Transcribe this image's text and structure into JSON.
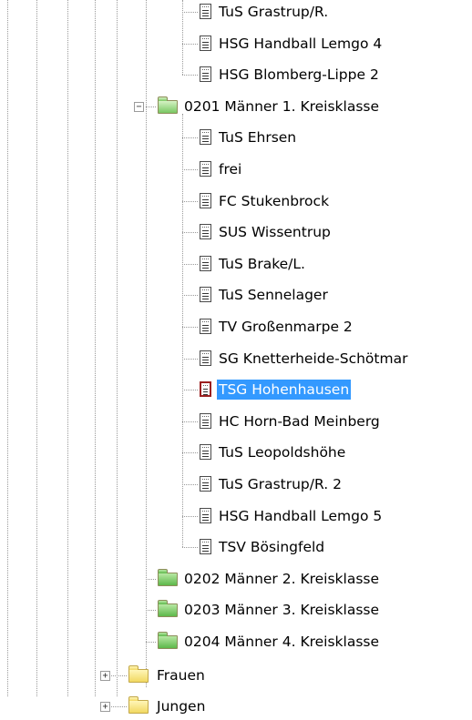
{
  "tree": {
    "teams_top": [
      {
        "label": "TuS Grastrup/R."
      },
      {
        "label": "HSG Handball Lemgo 4"
      },
      {
        "label": "HSG Blomberg-Lippe 2"
      }
    ],
    "league_open": {
      "label": "0201 Männer 1. Kreisklasse",
      "expander": "−"
    },
    "teams": [
      {
        "label": "TuS Ehrsen"
      },
      {
        "label": "frei"
      },
      {
        "label": "FC Stukenbrock"
      },
      {
        "label": "SUS Wissentrup"
      },
      {
        "label": "TuS Brake/L."
      },
      {
        "label": "TuS Sennelager"
      },
      {
        "label": "TV Großenmarpe 2"
      },
      {
        "label": "SG Knetterheide-Schötmar"
      },
      {
        "label": "TSG Hohenhausen",
        "selected": true
      },
      {
        "label": "HC Horn-Bad Meinberg"
      },
      {
        "label": "TuS Leopoldshöhe"
      },
      {
        "label": "TuS Grastrup/R. 2"
      },
      {
        "label": "HSG Handball Lemgo 5"
      },
      {
        "label": "TSV Bösingfeld"
      }
    ],
    "leagues_closed": [
      {
        "label": "0202 Männer 2. Kreisklasse"
      },
      {
        "label": "0203 Männer 3. Kreisklasse"
      },
      {
        "label": "0204 Männer 4. Kreisklasse"
      }
    ],
    "groups": [
      {
        "label": "Frauen",
        "expander": "+"
      },
      {
        "label": "Jungen",
        "expander": "+"
      }
    ]
  },
  "colors": {
    "selection": "#3399ff",
    "league_folder": "#5cb84a",
    "group_folder": "#f2d861"
  },
  "icons": {
    "team": "document-icon",
    "league": "folder-icon",
    "group": "folder-icon"
  }
}
